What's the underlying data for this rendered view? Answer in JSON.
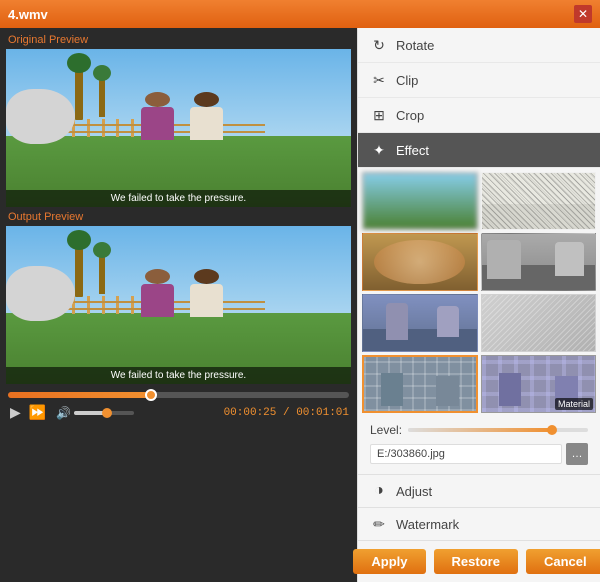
{
  "titlebar": {
    "title": "4.wmv"
  },
  "left": {
    "original_label": "Original Preview",
    "output_label": "Output Preview",
    "subtitle": "We failed to take the pressure.",
    "progress_percent": 42,
    "time_current": "00:00:25",
    "time_total": "00:01:01"
  },
  "right": {
    "nav": {
      "rotate_label": "Rotate",
      "clip_label": "Clip",
      "crop_label": "Crop",
      "effect_label": "Effect",
      "adjust_label": "Adjust",
      "watermark_label": "Watermark"
    },
    "effects": [
      {
        "id": "e1",
        "label": "",
        "type": "blur"
      },
      {
        "id": "e2",
        "label": "",
        "type": "sketch"
      },
      {
        "id": "e3",
        "label": "",
        "type": "warm"
      },
      {
        "id": "e4",
        "label": "",
        "type": "grayscale"
      },
      {
        "id": "e5",
        "label": "",
        "type": "cool"
      },
      {
        "id": "e6",
        "label": "",
        "type": "emboss"
      },
      {
        "id": "e7",
        "label": "",
        "type": "mosaic",
        "selected": true
      },
      {
        "id": "e8",
        "label": "Material",
        "type": "blocks",
        "selected": false
      }
    ],
    "level_label": "Level:",
    "level_value": 80,
    "filepath": "E:/303860.jpg",
    "buttons": {
      "apply": "Apply",
      "restore": "Restore",
      "cancel": "Cancel"
    }
  }
}
